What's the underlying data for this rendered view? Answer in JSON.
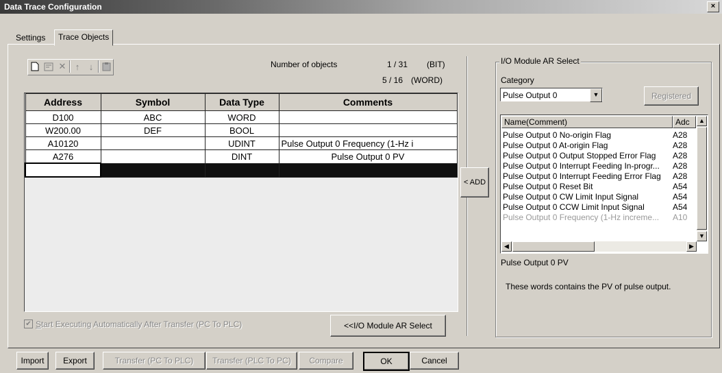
{
  "window": {
    "title": "Data Trace Configuration",
    "close_glyph": "×"
  },
  "tabs": [
    {
      "label": "Settings",
      "active": false
    },
    {
      "label": "Trace Objects",
      "active": true
    }
  ],
  "counts": {
    "label": "Number of objects",
    "bit_value": "1 / 31",
    "bit_unit": "(BIT)",
    "word_value": "5 / 16",
    "word_unit": "(WORD)"
  },
  "toolbar": {
    "icons": [
      "new-icon",
      "edit-icon",
      "delete-icon",
      "move-up-icon",
      "move-down-icon",
      "paste-icon"
    ]
  },
  "grid": {
    "columns": [
      "Address",
      "Symbol",
      "Data Type",
      "Comments"
    ],
    "rows": [
      {
        "address": "D100",
        "symbol": "ABC",
        "type": "WORD",
        "comment": ""
      },
      {
        "address": "W200.00",
        "symbol": "DEF",
        "type": "BOOL",
        "comment": ""
      },
      {
        "address": "A10120",
        "symbol": "",
        "type": "UDINT",
        "comment": "Pulse Output 0 Frequency (1-Hz i"
      },
      {
        "address": "A276",
        "symbol": "",
        "type": "DINT",
        "comment": "Pulse Output 0 PV"
      }
    ]
  },
  "checkbox": {
    "label": "Start Executing Automatically After Transfer (PC To PLC)",
    "checked": true,
    "enabled": false
  },
  "io_select_button": "<<I/O Module AR Select",
  "add_button": "< ADD",
  "io_module": {
    "group_title": "I/O Module AR Select",
    "category_label": "Category",
    "category_value": "Pulse Output 0",
    "registered_button": "Registered",
    "list_columns": [
      "Name(Comment)",
      "Adc"
    ],
    "items": [
      {
        "name": "Pulse Output 0 No-origin Flag",
        "addr": "A28",
        "dim": false
      },
      {
        "name": "Pulse Output 0 At-origin Flag",
        "addr": "A28",
        "dim": false
      },
      {
        "name": "Pulse Output 0 Output Stopped Error Flag",
        "addr": "A28",
        "dim": false
      },
      {
        "name": "Pulse Output 0 Interrupt Feeding In-progr...",
        "addr": "A28",
        "dim": false
      },
      {
        "name": "Pulse Output 0 Interrupt Feeding Error Flag",
        "addr": "A28",
        "dim": false
      },
      {
        "name": "Pulse Output 0 Reset Bit",
        "addr": "A54",
        "dim": false
      },
      {
        "name": "Pulse Output 0 CW Limit Input Signal",
        "addr": "A54",
        "dim": false
      },
      {
        "name": "Pulse Output 0 CCW Limit Input Signal",
        "addr": "A54",
        "dim": false
      },
      {
        "name": "Pulse Output 0 Frequency (1-Hz increme...",
        "addr": "A10",
        "dim": true
      }
    ],
    "selected_name": "Pulse Output 0 PV",
    "description": "These words contains the PV of pulse output."
  },
  "footer": {
    "import": "Import",
    "export": "Export",
    "transfer_pc_to_plc": "Transfer (PC To PLC)",
    "transfer_plc_to_pc": "Transfer (PLC To PC)",
    "compare": "Compare",
    "ok": "OK",
    "cancel": "Cancel"
  }
}
